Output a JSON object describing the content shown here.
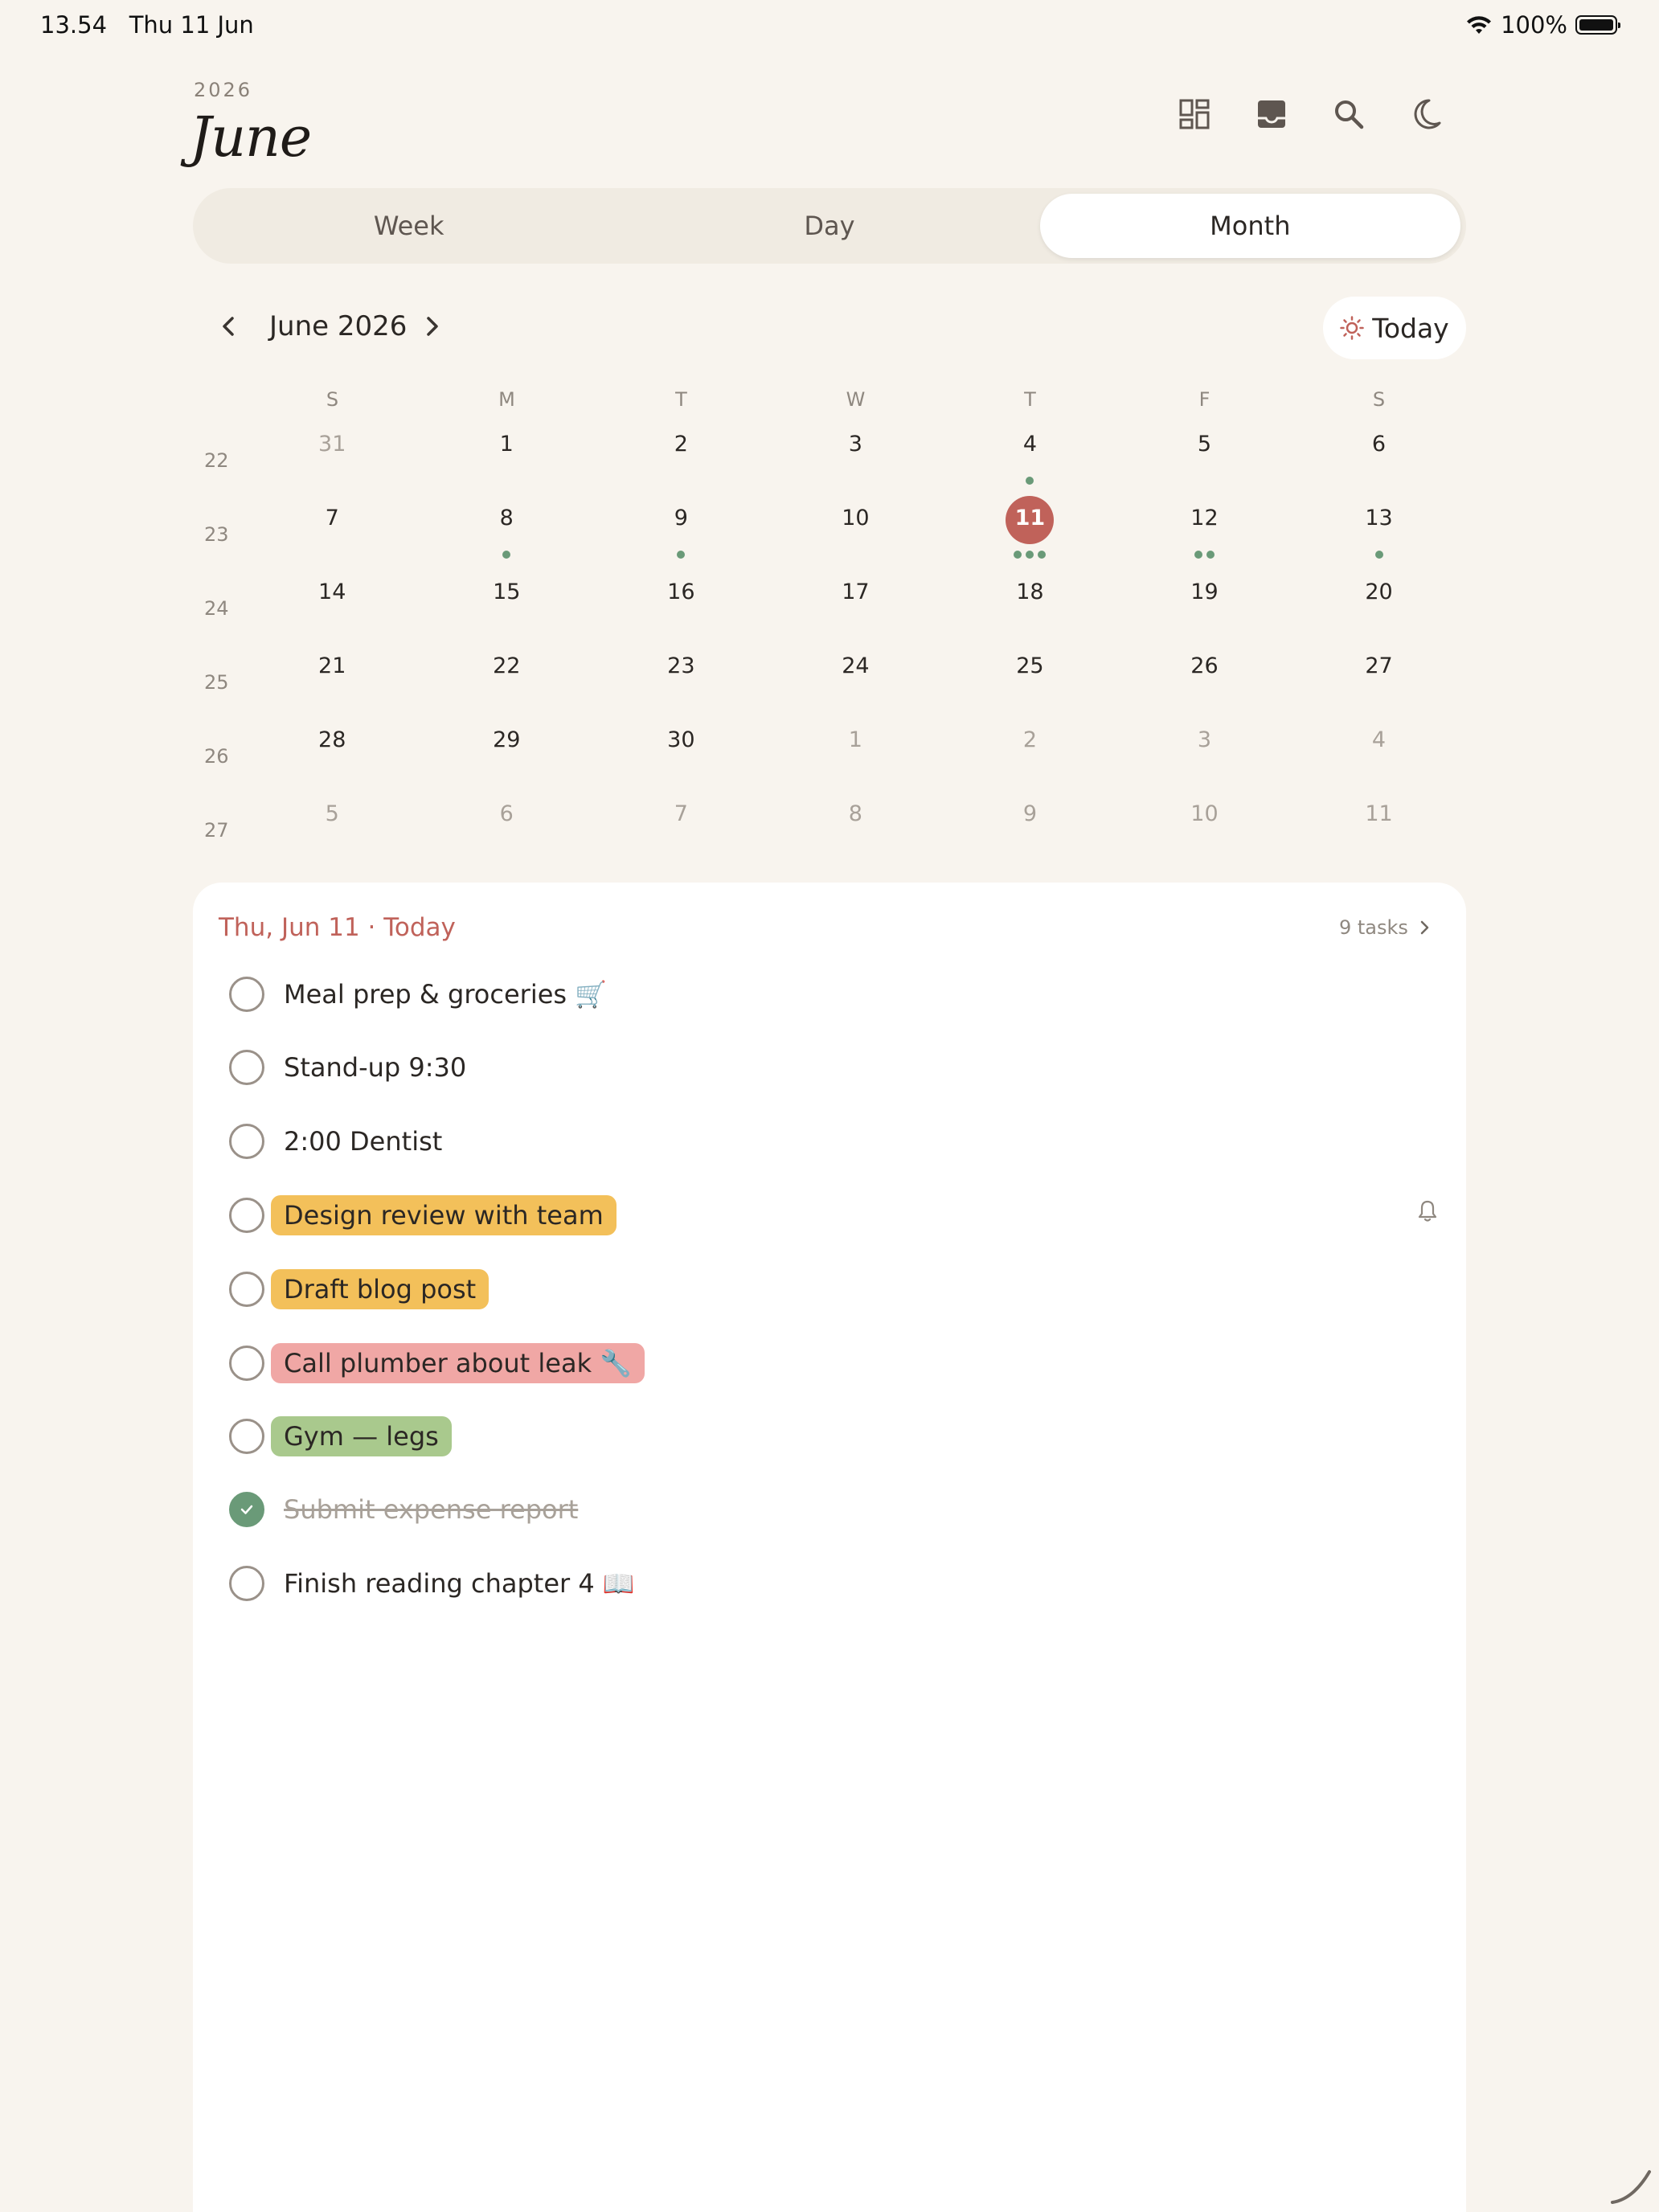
{
  "status_bar": {
    "time": "13.54",
    "date": "Thu 11 Jun",
    "battery": "100%"
  },
  "header": {
    "year": "2026",
    "month": "June",
    "icons": [
      "widgets-icon",
      "inbox-icon",
      "search-icon",
      "moon-icon"
    ]
  },
  "view_switcher": {
    "week": "Week",
    "day": "Day",
    "month": "Month",
    "selected": "Month"
  },
  "calendar_nav": {
    "label": "June 2026",
    "today_label": "Today"
  },
  "calendar": {
    "weekday_headers": [
      "S",
      "M",
      "T",
      "W",
      "T",
      "F",
      "S"
    ],
    "weeks": [
      {
        "number": "22",
        "days": [
          {
            "d": "31",
            "outside": true,
            "dots": 0
          },
          {
            "d": "1",
            "dots": 0
          },
          {
            "d": "2",
            "dots": 0
          },
          {
            "d": "3",
            "dots": 0
          },
          {
            "d": "4",
            "dots": 1
          },
          {
            "d": "5",
            "dots": 0
          },
          {
            "d": "6",
            "dots": 0
          }
        ]
      },
      {
        "number": "23",
        "days": [
          {
            "d": "7",
            "dots": 0
          },
          {
            "d": "8",
            "dots": 1
          },
          {
            "d": "9",
            "dots": 1
          },
          {
            "d": "10",
            "dots": 0
          },
          {
            "d": "11",
            "dots": 3,
            "today": true
          },
          {
            "d": "12",
            "dots": 2
          },
          {
            "d": "13",
            "dots": 1
          }
        ]
      },
      {
        "number": "24",
        "days": [
          {
            "d": "14",
            "dots": 0
          },
          {
            "d": "15",
            "dots": 0
          },
          {
            "d": "16",
            "dots": 0
          },
          {
            "d": "17",
            "dots": 0
          },
          {
            "d": "18",
            "dots": 0
          },
          {
            "d": "19",
            "dots": 0
          },
          {
            "d": "20",
            "dots": 0
          }
        ]
      },
      {
        "number": "25",
        "days": [
          {
            "d": "21",
            "dots": 0
          },
          {
            "d": "22",
            "dots": 0
          },
          {
            "d": "23",
            "dots": 0
          },
          {
            "d": "24",
            "dots": 0
          },
          {
            "d": "25",
            "dots": 0
          },
          {
            "d": "26",
            "dots": 0
          },
          {
            "d": "27",
            "dots": 0
          }
        ]
      },
      {
        "number": "26",
        "days": [
          {
            "d": "28",
            "dots": 0
          },
          {
            "d": "29",
            "dots": 0
          },
          {
            "d": "30",
            "dots": 0
          },
          {
            "d": "1",
            "outside": true,
            "dots": 0
          },
          {
            "d": "2",
            "outside": true,
            "dots": 0
          },
          {
            "d": "3",
            "outside": true,
            "dots": 0
          },
          {
            "d": "4",
            "outside": true,
            "dots": 0
          }
        ]
      },
      {
        "number": "27",
        "days": [
          {
            "d": "5",
            "outside": true,
            "dots": 0
          },
          {
            "d": "6",
            "outside": true,
            "dots": 0
          },
          {
            "d": "7",
            "outside": true,
            "dots": 0
          },
          {
            "d": "8",
            "outside": true,
            "dots": 0
          },
          {
            "d": "9",
            "outside": true,
            "dots": 0
          },
          {
            "d": "10",
            "outside": true,
            "dots": 0
          },
          {
            "d": "11",
            "outside": true,
            "dots": 0
          }
        ]
      }
    ]
  },
  "task_panel": {
    "title": "Thu, Jun 11 · Today",
    "count": "9 tasks",
    "tasks": [
      {
        "text": "Meal prep & groceries 🛒",
        "done": false,
        "tag_color": ""
      },
      {
        "text": "Stand-up 9:30",
        "done": false,
        "tag_color": ""
      },
      {
        "text": "2:00 Dentist",
        "done": false,
        "tag_color": ""
      },
      {
        "text": "Design review with team",
        "done": false,
        "tag_color": "#f3c05a",
        "reminder": true
      },
      {
        "text": "Draft blog post",
        "done": false,
        "tag_color": "#f3c05a"
      },
      {
        "text": "Call plumber about leak 🔧",
        "done": false,
        "tag_color": "#f0a7a5"
      },
      {
        "text": "Gym — legs",
        "done": false,
        "tag_color": "#a9c98d"
      },
      {
        "text": "Submit expense report",
        "done": true,
        "tag_color": ""
      },
      {
        "text": "Finish reading chapter 4 📖",
        "done": false,
        "tag_color": ""
      }
    ]
  },
  "colors": {
    "accent": "#c0625a",
    "dot": "#6a9a78",
    "background": "#f8f4ee"
  }
}
